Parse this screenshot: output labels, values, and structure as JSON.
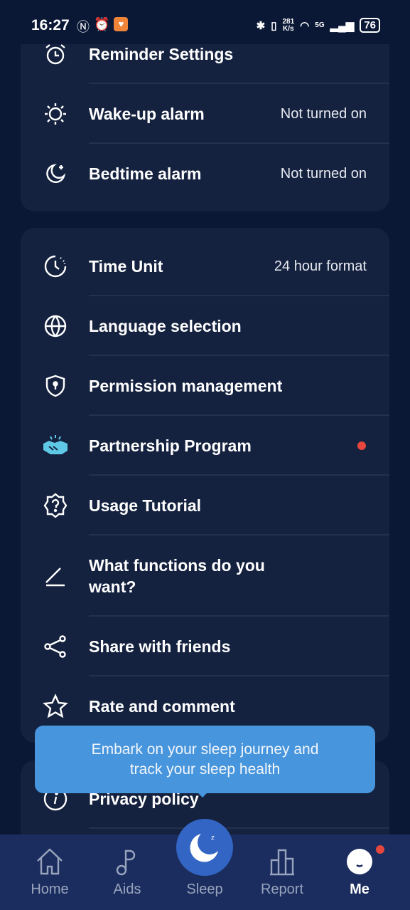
{
  "status_bar": {
    "time": "16:27",
    "net_speed_top": "281",
    "net_speed_unit": "K/s",
    "battery": "76",
    "network": "5G"
  },
  "card1": [
    {
      "icon": "alarm-clock-icon",
      "label": "Reminder Settings",
      "value": ""
    },
    {
      "icon": "sun-icon",
      "label": "Wake-up alarm",
      "value": "Not turned on"
    },
    {
      "icon": "moon-star-icon",
      "label": "Bedtime alarm",
      "value": "Not turned on"
    }
  ],
  "card2": [
    {
      "icon": "clock-icon",
      "label": "Time Unit",
      "value": "24 hour format"
    },
    {
      "icon": "globe-icon",
      "label": "Language selection",
      "value": ""
    },
    {
      "icon": "shield-icon",
      "label": "Permission management",
      "value": ""
    },
    {
      "icon": "handshake-icon",
      "label": "Partnership Program",
      "value": "",
      "badge": true
    },
    {
      "icon": "help-badge-icon",
      "label": "Usage Tutorial",
      "value": ""
    },
    {
      "icon": "pen-icon",
      "label": "What functions do you want?",
      "value": ""
    },
    {
      "icon": "share-icon",
      "label": "Share with friends",
      "value": ""
    },
    {
      "icon": "star-icon",
      "label": "Rate and comment",
      "value": ""
    }
  ],
  "card3": [
    {
      "icon": "info-icon",
      "label": "Privacy policy",
      "value": ""
    }
  ],
  "tooltip": {
    "line1": "Embark on your sleep journey and",
    "line2": "track your sleep health"
  },
  "nav": {
    "tabs": [
      {
        "label": "Home"
      },
      {
        "label": "Aids"
      },
      {
        "label": "Sleep"
      },
      {
        "label": "Report"
      },
      {
        "label": "Me",
        "active": true,
        "badge": true
      }
    ]
  },
  "colors": {
    "background": "#0a1836",
    "card": "#15223f",
    "nav": "#1b2d5e",
    "tooltip": "#4795dc",
    "accent": "#3265c4",
    "badge": "#e5473f"
  }
}
